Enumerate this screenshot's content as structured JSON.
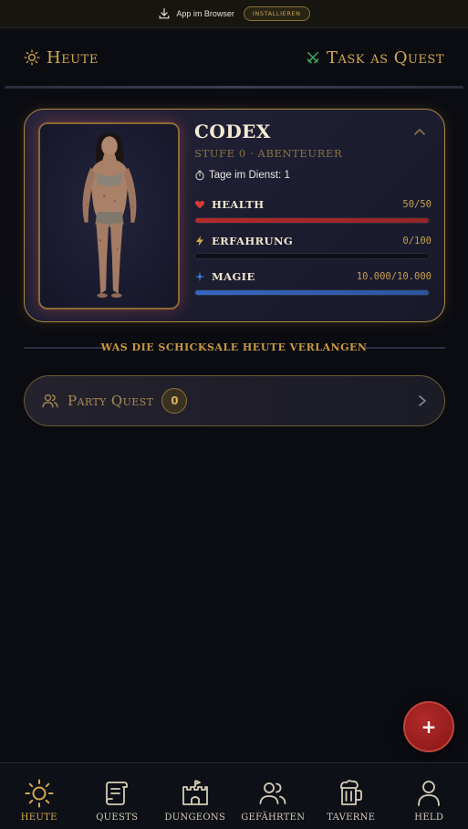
{
  "install_bar": {
    "text": "App im Browser",
    "button_label": "INSTALLIEREN"
  },
  "header": {
    "left_title": "Heute",
    "left_icon": "sun-icon",
    "right_title": "Task as Quest",
    "right_icon": "crossed-swords-icon"
  },
  "hero": {
    "name": "CODEX",
    "level": "STUFE 0 · ABENTEURER",
    "days_label": "Tage im Dienst: 1",
    "stats": [
      {
        "label": "HEALTH",
        "value": "50/50",
        "icon": "heart-icon",
        "color": "#b52a2a",
        "fraction": 1.0
      },
      {
        "label": "ERFAHRUNG",
        "value": "0/100",
        "icon": "lightning-icon",
        "color": "#d4a94d",
        "fraction": 0.0
      },
      {
        "label": "MAGIE",
        "value": "10.000/10.000",
        "icon": "sparkle-icon",
        "color": "#3566c0",
        "fraction": 1.0
      }
    ]
  },
  "section": {
    "title": "WAS DIE SCHICKSALE HEUTE VERLANGEN"
  },
  "party_quest": {
    "label": "Party Quest",
    "count": "0"
  },
  "fab": {
    "label": "+"
  },
  "nav": {
    "items": [
      {
        "label": "HEUTE",
        "icon": "sun-icon",
        "active": true
      },
      {
        "label": "QUESTS",
        "icon": "scroll-icon",
        "active": false
      },
      {
        "label": "DUNGEONS",
        "icon": "castle-icon",
        "active": false
      },
      {
        "label": "GEFÄHRTEN",
        "icon": "users-icon",
        "active": false
      },
      {
        "label": "TAVERNE",
        "icon": "beer-mug-icon",
        "active": false
      },
      {
        "label": "HELD",
        "icon": "user-icon",
        "active": false
      }
    ]
  },
  "colors": {
    "accent_gold": "#d4a94d",
    "background": "#0b0c12",
    "health": "#b52a2a",
    "mana": "#3566c0",
    "fab": "#9a1e1e"
  }
}
